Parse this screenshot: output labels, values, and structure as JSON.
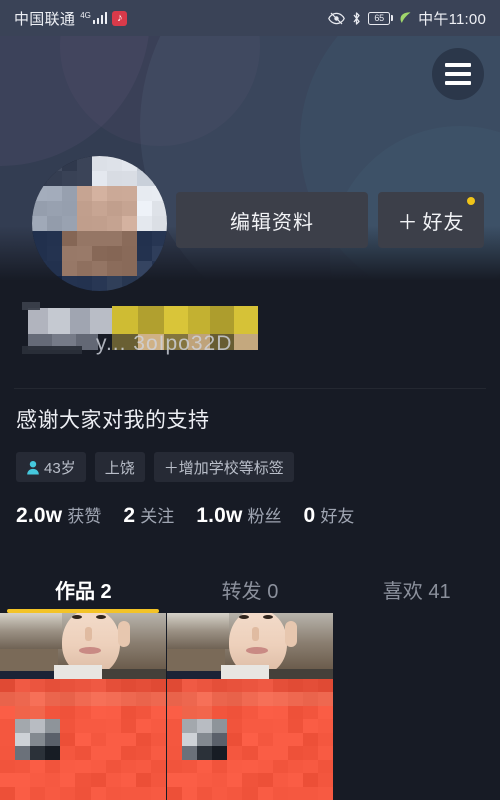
{
  "status_bar": {
    "carrier": "中国联通",
    "network_type": "4G",
    "app_icon": "douyin-icon",
    "battery_level": "65",
    "clock": "中午11:00",
    "icons": [
      "eye-icon",
      "bluetooth-icon",
      "battery-icon",
      "leaf-icon"
    ]
  },
  "header": {
    "menu_label": "menu",
    "background_color": "#333d52"
  },
  "profile": {
    "avatar_alt": "user-avatar",
    "display_name_redacted": "y... 3oIpo32D",
    "bio": "感谢大家对我的支持",
    "buttons": {
      "edit_profile": "编辑资料",
      "add_friend_plus": "＋",
      "add_friend": "好友",
      "badge_color": "#f0c419"
    },
    "tags": [
      {
        "icon": "person-icon",
        "label": "43岁"
      },
      {
        "icon": "",
        "label": "上饶"
      },
      {
        "icon": "",
        "label": "＋增加学校等标签"
      }
    ],
    "stats": [
      {
        "value": "2.0w",
        "label": "获赞"
      },
      {
        "value": "2",
        "label": "关注"
      },
      {
        "value": "1.0w",
        "label": "粉丝"
      },
      {
        "value": "0",
        "label": "好友"
      }
    ]
  },
  "tabs": [
    {
      "label": "作品 2",
      "active": true
    },
    {
      "label": "转发 0",
      "active": false
    },
    {
      "label": "喜欢 41",
      "active": false
    }
  ],
  "tab_indicator_color": "#f3c327",
  "grid": {
    "items": [
      {
        "name": "video-thumbnail-1",
        "overlay_color": "#f4573f"
      },
      {
        "name": "video-thumbnail-2",
        "overlay_color": "#f4573f"
      }
    ],
    "empty_slots": 1
  },
  "colors": {
    "page_background": "#171b25",
    "banner": "#333d52",
    "button_bg": "#3c3f49",
    "accent_yellow": "#f3c327",
    "tag_cyan": "#45c8dd"
  }
}
